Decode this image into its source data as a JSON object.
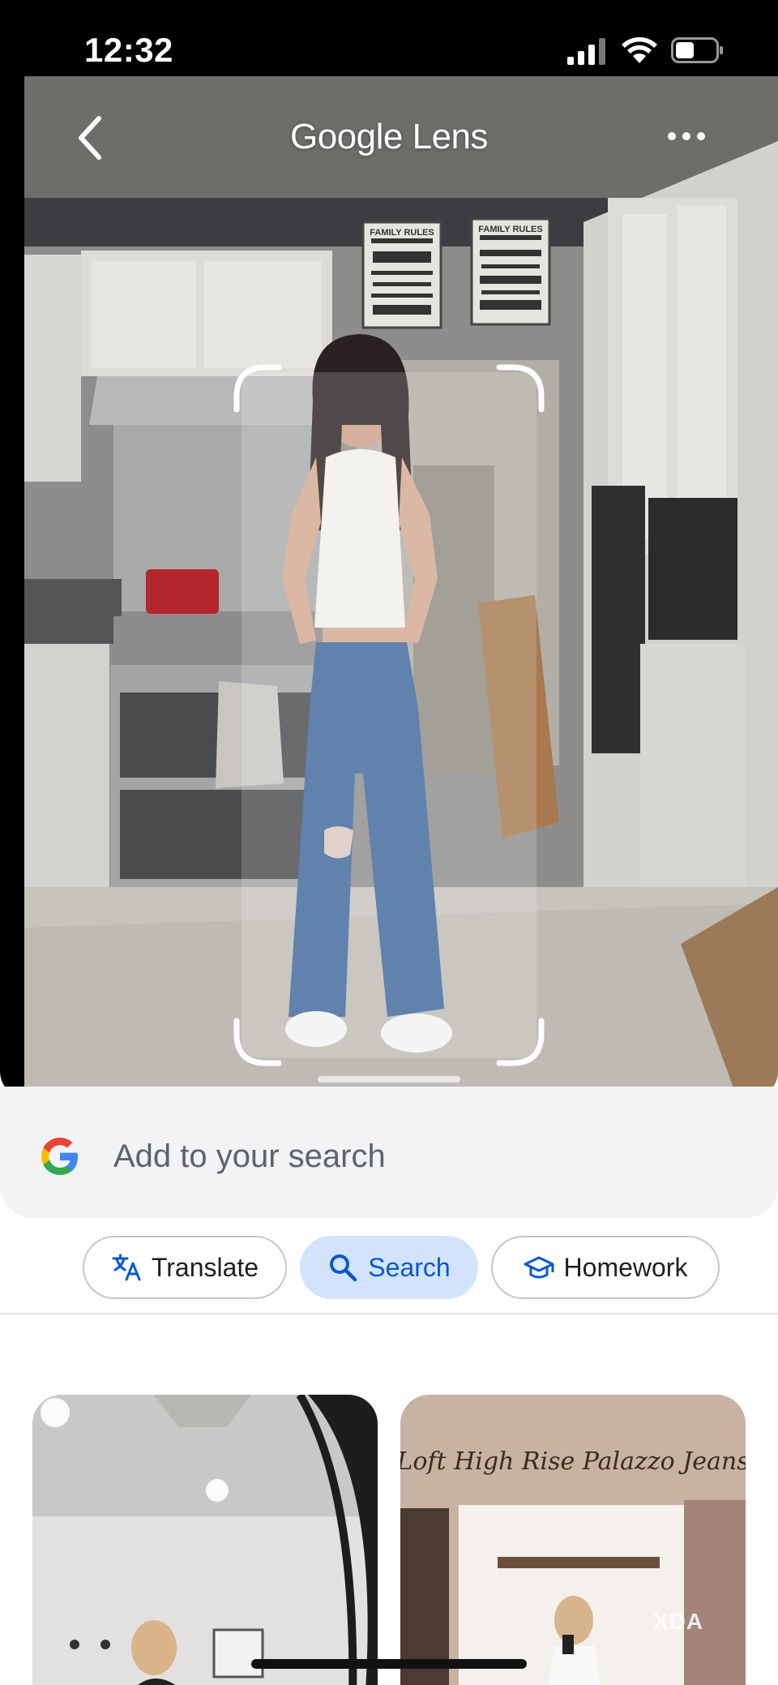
{
  "status_bar": {
    "time": "12:32",
    "signal_icon": "cellular-signal-icon",
    "wifi_icon": "wifi-icon",
    "battery_icon": "battery-icon"
  },
  "header": {
    "title": "Google Lens",
    "back_icon": "chevron-left-icon",
    "more_icon": "more-horizontal-icon"
  },
  "photo": {
    "sign_left": "FAMILY RULES",
    "sign_right": "FAMILY RULES"
  },
  "search": {
    "placeholder": "Add to your search",
    "logo_icon": "google-g-icon"
  },
  "chips": [
    {
      "label": "Translate",
      "icon": "translate-icon",
      "active": false
    },
    {
      "label": "Search",
      "icon": "search-icon",
      "active": true
    },
    {
      "label": "Homework",
      "icon": "school-cap-icon",
      "active": false
    }
  ],
  "results": [
    {
      "caption": ""
    },
    {
      "caption": "Loft High Rise Palazzo Jeans"
    }
  ],
  "watermark": "XDA",
  "colors": {
    "accent": "#0b57d0",
    "chip_active_bg": "#d3e3fd",
    "search_bg": "#f1f3f4"
  }
}
